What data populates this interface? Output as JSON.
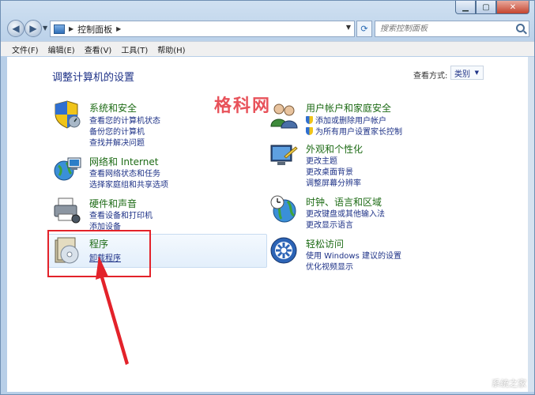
{
  "window": {
    "address": {
      "crumb": "控制面板"
    },
    "search": {
      "placeholder": "搜索控制面板"
    }
  },
  "menu": [
    "文件(F)",
    "编辑(E)",
    "查看(V)",
    "工具(T)",
    "帮助(H)"
  ],
  "content": {
    "heading": "调整计算机的设置",
    "view_by_label": "查看方式:",
    "view_by_value": "类别",
    "watermark": "格科网"
  },
  "categories": {
    "system_security": {
      "title": "系统和安全",
      "links": [
        "查看您的计算机状态",
        "备份您的计算机",
        "查找并解决问题"
      ]
    },
    "network": {
      "title": "网络和 Internet",
      "links": [
        "查看网络状态和任务",
        "选择家庭组和共享选项"
      ]
    },
    "hardware": {
      "title": "硬件和声音",
      "links": [
        "查看设备和打印机",
        "添加设备"
      ]
    },
    "programs": {
      "title": "程序",
      "links": [
        "卸载程序"
      ]
    },
    "user_accounts": {
      "title": "用户帐户和家庭安全",
      "links": [
        "添加或删除用户帐户",
        "为所有用户设置家长控制"
      ]
    },
    "appearance": {
      "title": "外观和个性化",
      "links": [
        "更改主题",
        "更改桌面背景",
        "调整屏幕分辨率"
      ]
    },
    "clock": {
      "title": "时钟、语言和区域",
      "links": [
        "更改键盘或其他输入法",
        "更改显示语言"
      ]
    },
    "ease": {
      "title": "轻松访问",
      "links": [
        "使用 Windows 建议的设置",
        "优化视频显示"
      ]
    }
  },
  "colors": {
    "accent_link": "#1e3287",
    "category_title": "#1d6b15",
    "highlight": "#e3222a"
  },
  "footer_watermark": "系统之家"
}
